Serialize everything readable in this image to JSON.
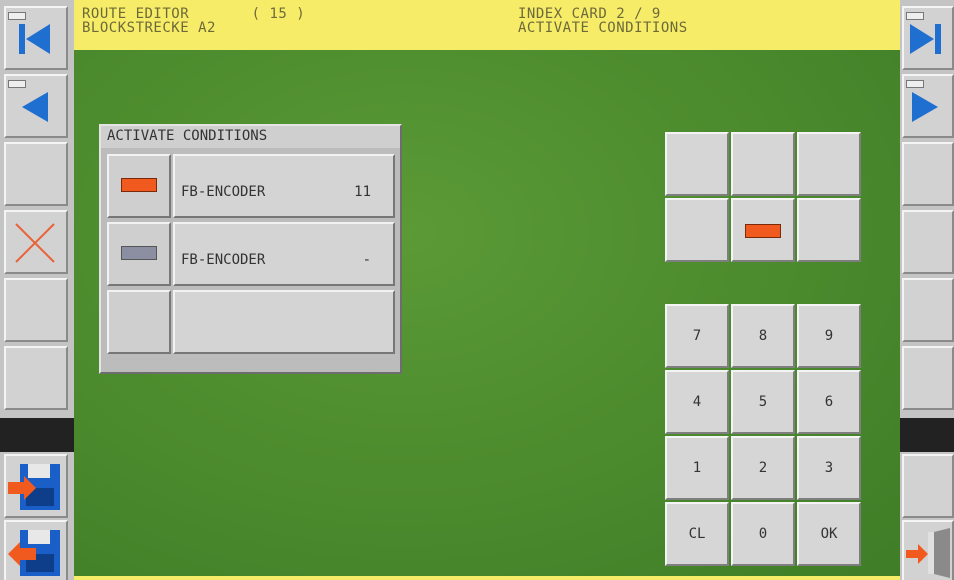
{
  "header": {
    "left_line1": "ROUTE EDITOR       ( 15 )",
    "left_line2": "BLOCKSTRECKE A2",
    "right_line1": "INDEX CARD 2 / 9",
    "right_line2": "ACTIVATE CONDITIONS"
  },
  "conditions_panel": {
    "title": "ACTIVATE CONDITIONS",
    "rows": [
      {
        "label": "FB-ENCODER",
        "value": "11",
        "indicator": "orange"
      },
      {
        "label": "FB-ENCODER",
        "value": "-",
        "indicator": "grey"
      },
      {
        "label": "",
        "value": "",
        "indicator": "none"
      }
    ]
  },
  "keypad": {
    "keys": [
      "7",
      "8",
      "9",
      "4",
      "5",
      "6",
      "1",
      "2",
      "3",
      "CL",
      "0",
      "OK"
    ]
  },
  "icons": {
    "first": "first-card-icon",
    "prev": "prev-card-icon",
    "next": "next-card-icon",
    "last": "last-card-icon",
    "delete": "delete-x-icon",
    "save": "save-disk-icon",
    "load": "load-disk-icon",
    "exit": "exit-door-icon"
  },
  "colors": {
    "header_bg": "#f6ec68",
    "background": "#4a8a2c",
    "indicator_active": "#f05a1e",
    "indicator_inactive": "#8c8fa2",
    "nav_blue": "#1f6fd0"
  }
}
